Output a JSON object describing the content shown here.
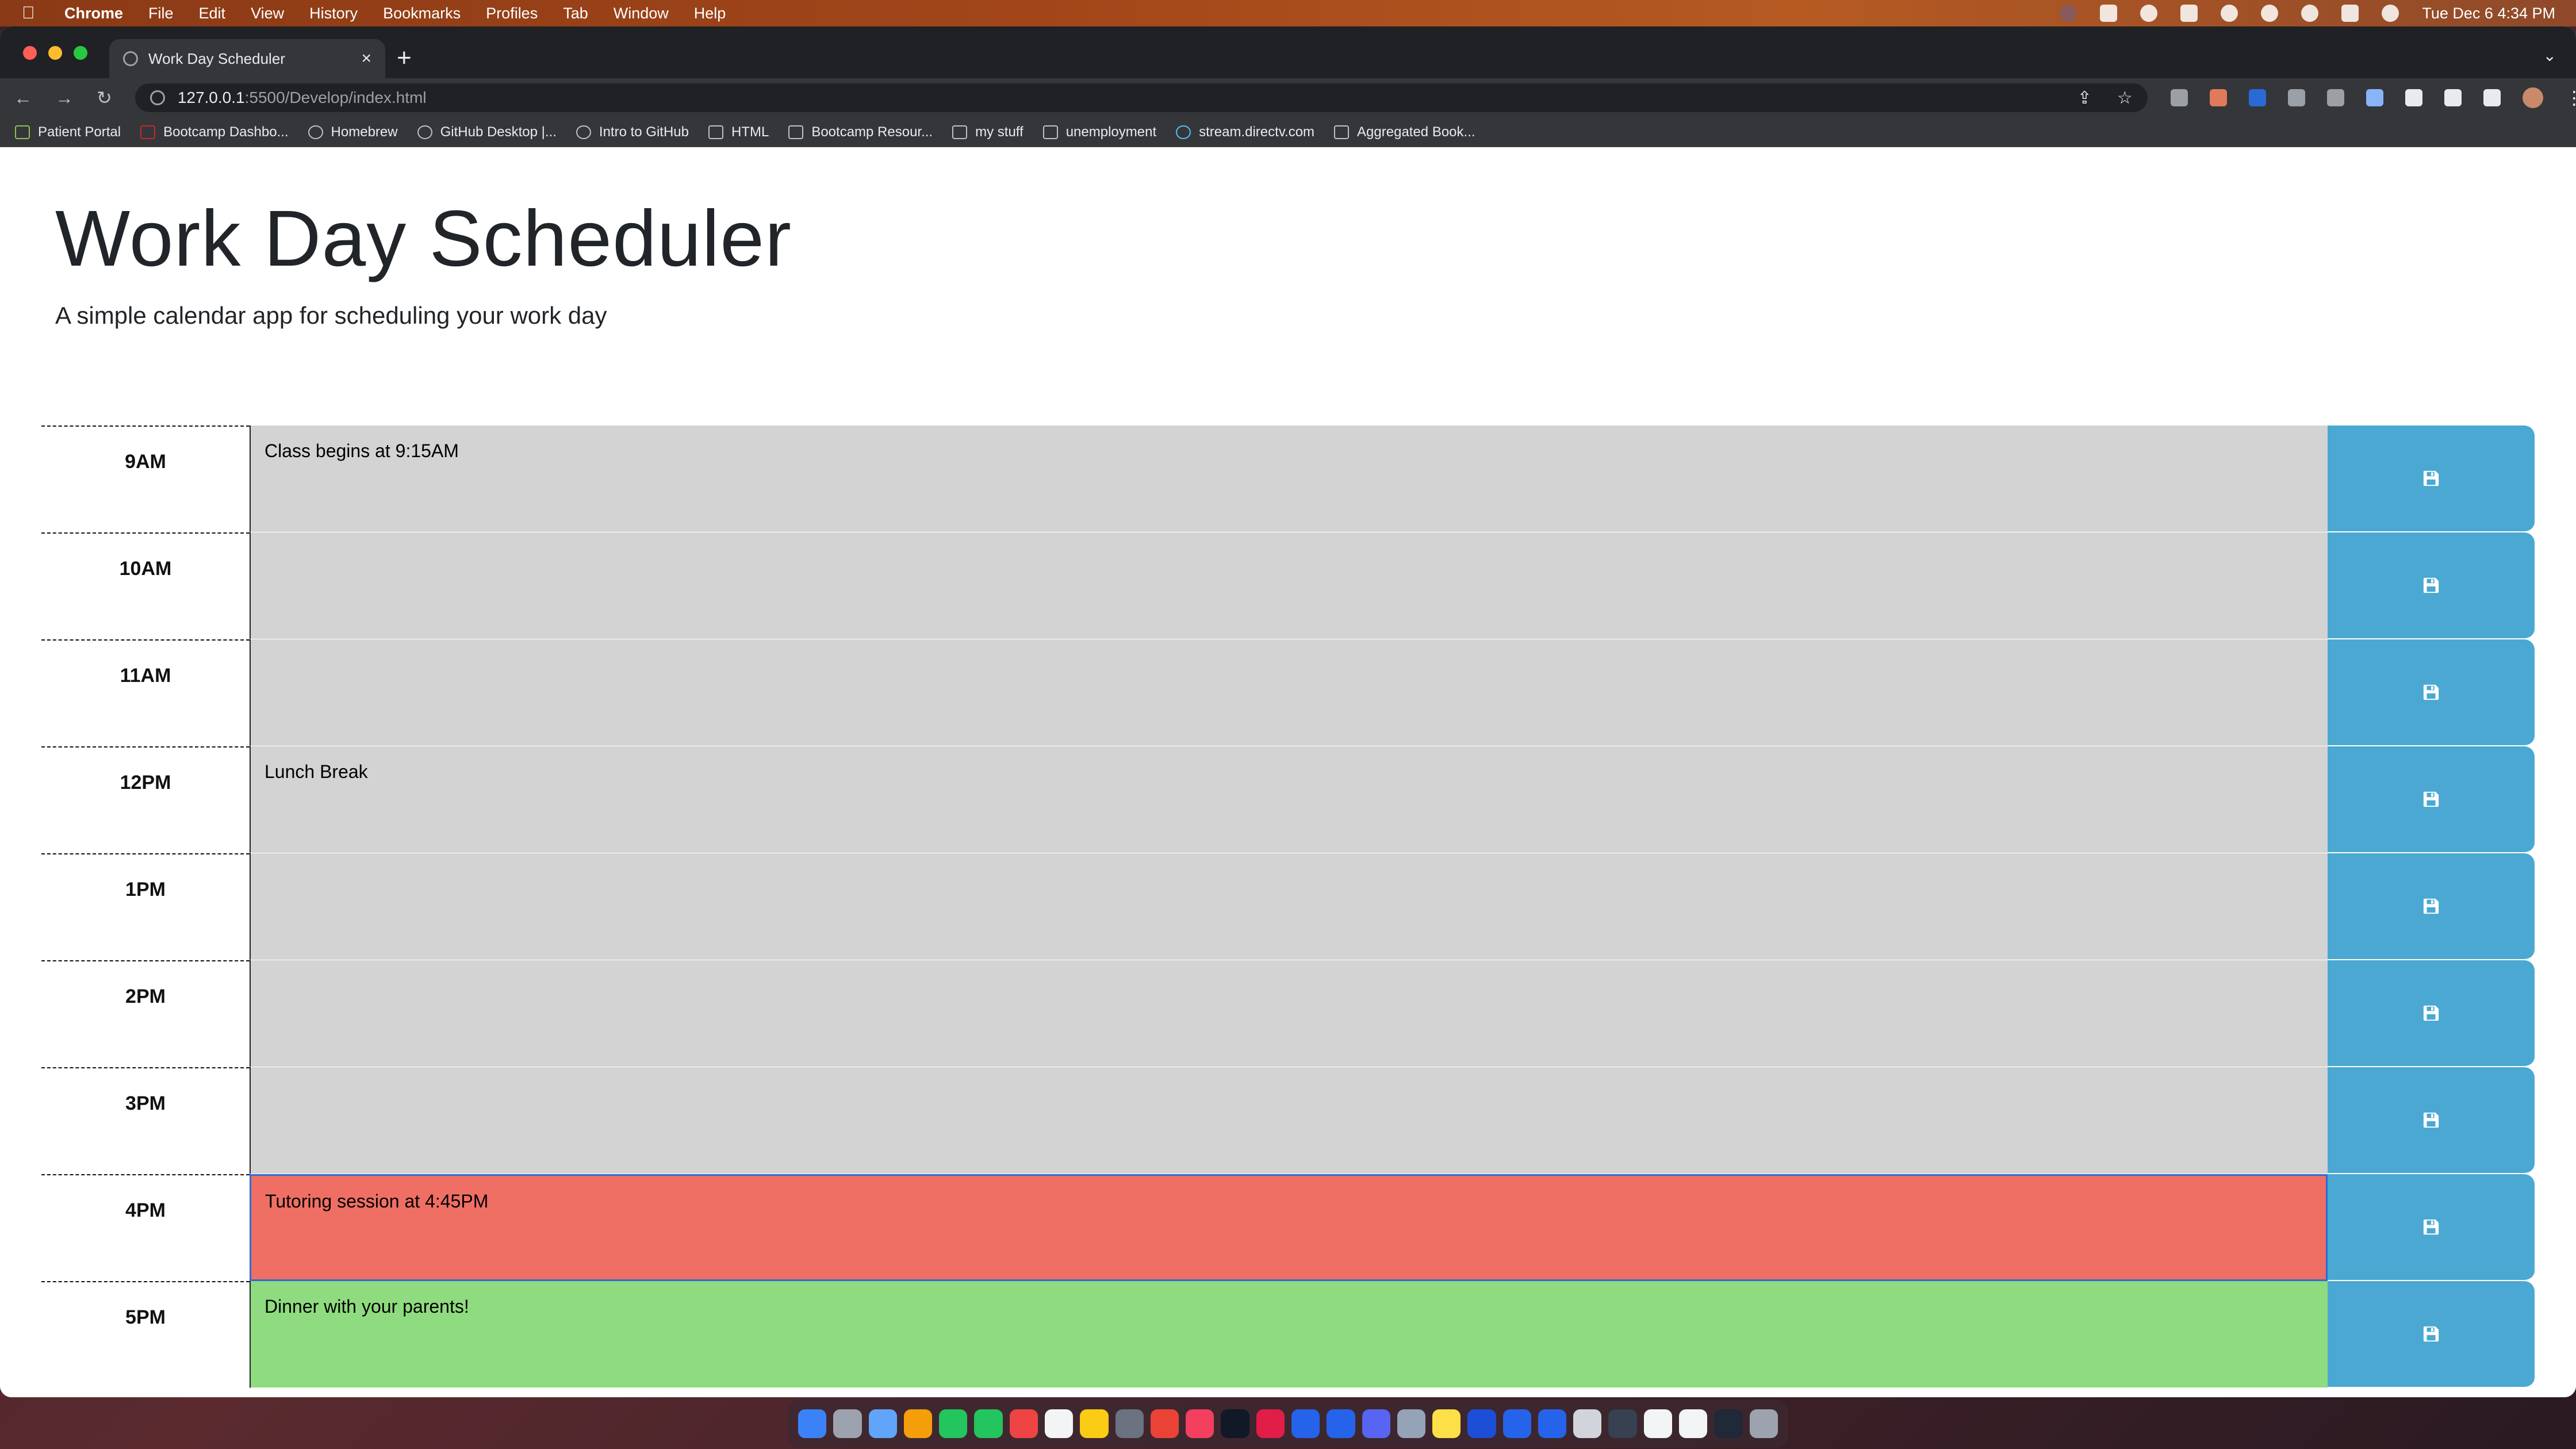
{
  "menubar": {
    "app": "Chrome",
    "items": [
      "File",
      "Edit",
      "View",
      "History",
      "Bookmarks",
      "Profiles",
      "Tab",
      "Window",
      "Help"
    ],
    "clock": "Tue Dec 6  4:34 PM"
  },
  "browser": {
    "tab_title": "Work Day Scheduler",
    "url_host": "127.0.0.1",
    "url_path": ":5500/Develop/index.html",
    "bookmarks": [
      "Patient Portal",
      "Bootcamp Dashbo...",
      "Homebrew",
      "GitHub Desktop |...",
      "Intro to GitHub",
      "HTML",
      "Bootcamp Resour...",
      "my stuff",
      "unemployment",
      "stream.directv.com",
      "Aggregated Book..."
    ]
  },
  "header": {
    "title": "Work Day Scheduler",
    "subtitle": "A simple calendar app for scheduling your work day"
  },
  "schedule": [
    {
      "hour": "9AM",
      "text": "Class begins at 9:15AM",
      "state": "past"
    },
    {
      "hour": "10AM",
      "text": "",
      "state": "past"
    },
    {
      "hour": "11AM",
      "text": "",
      "state": "past"
    },
    {
      "hour": "12PM",
      "text": "Lunch Break",
      "state": "past"
    },
    {
      "hour": "1PM",
      "text": "",
      "state": "past"
    },
    {
      "hour": "2PM",
      "text": "",
      "state": "past"
    },
    {
      "hour": "3PM",
      "text": "",
      "state": "past"
    },
    {
      "hour": "4PM",
      "text": "Tutoring session at 4:45PM",
      "state": "present"
    },
    {
      "hour": "5PM",
      "text": "Dinner with your parents!",
      "state": "future"
    }
  ],
  "colors": {
    "past": "#d3d3d3",
    "present": "#ef6f64",
    "future": "#8fdb7f",
    "save_button": "#4aa8d2"
  },
  "icons": {
    "save": "floppy-disk-icon"
  }
}
